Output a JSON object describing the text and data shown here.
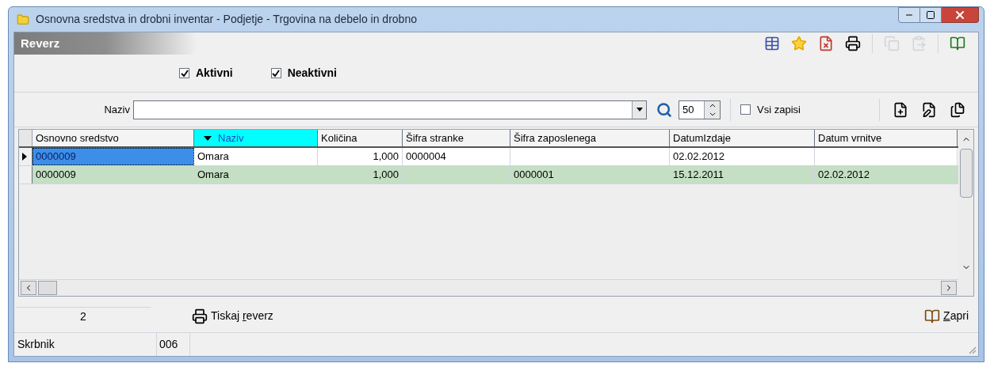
{
  "window": {
    "title": "Osnovna sredstva in drobni inventar - Podjetje - Trgovina na debelo in drobno"
  },
  "panel": {
    "title": "Reverz"
  },
  "toolbar": [
    {
      "kind": "table",
      "disabled": false
    },
    {
      "kind": "star",
      "disabled": false
    },
    {
      "kind": "delete",
      "disabled": false
    },
    {
      "kind": "print",
      "disabled": false
    },
    {
      "kind": "sep"
    },
    {
      "kind": "copy",
      "disabled": true
    },
    {
      "kind": "paste",
      "disabled": true
    },
    {
      "kind": "sep"
    },
    {
      "kind": "help",
      "disabled": false
    }
  ],
  "filters": [
    {
      "label": "Aktivni",
      "checked": true
    },
    {
      "label": "Neaktivni",
      "checked": true
    }
  ],
  "search": {
    "label": "Naziv",
    "count": "50",
    "all_label": "Vsi zapisi",
    "all_checked": false
  },
  "actions": [
    {
      "kind": "new"
    },
    {
      "kind": "edit"
    },
    {
      "kind": "edit-all"
    }
  ],
  "table": {
    "columns": [
      {
        "label": "Osnovno sredstvo",
        "sorted": false
      },
      {
        "label": "Naziv",
        "sorted": true
      },
      {
        "label": "Količina",
        "sorted": false
      },
      {
        "label": "Šifra stranke",
        "sorted": false
      },
      {
        "label": "Šifra zaposlenega",
        "sorted": false
      },
      {
        "label": "DatumIzdaje",
        "sorted": false
      },
      {
        "label": "Datum vrnitve",
        "sorted": false
      }
    ],
    "rows": [
      {
        "selected": true,
        "color": "#ffffff",
        "cells": [
          "0000009",
          "Omara",
          "1,000",
          "0000004",
          "",
          "02.02.2012",
          ""
        ]
      },
      {
        "selected": false,
        "color": "#c4dfc4",
        "cells": [
          "0000009",
          "Omara",
          "1,000",
          "",
          "0000001",
          "15.12.2011",
          "02.02.2012"
        ]
      }
    ]
  },
  "footer": {
    "count": "2",
    "print_button": {
      "label": "Tiskaj reverz"
    },
    "close_button": {
      "label": "Zapri"
    }
  },
  "status_bar": {
    "user": "Skrbnik",
    "code": "006"
  }
}
